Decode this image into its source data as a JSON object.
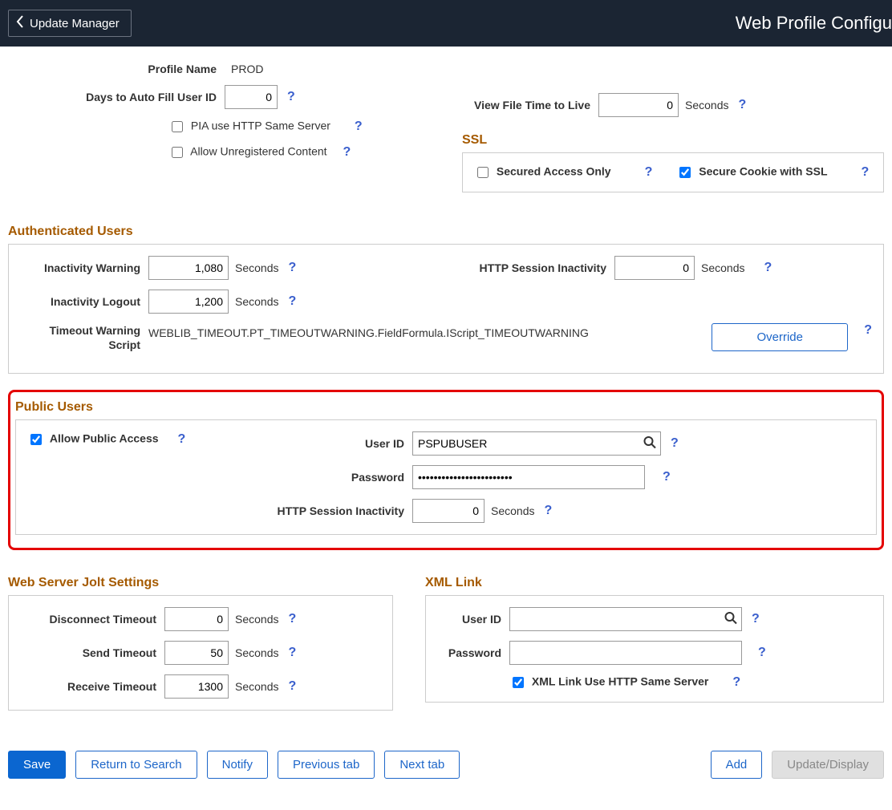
{
  "header": {
    "back_label": "Update Manager",
    "title": "Web Profile Configu"
  },
  "profile": {
    "name_label": "Profile Name",
    "name_value": "PROD",
    "days_autofill_label": "Days to Auto Fill User ID",
    "days_autofill_value": "0",
    "pia_same_server_label": "PIA use HTTP Same Server",
    "pia_same_server_checked": false,
    "allow_unreg_label": "Allow Unregistered Content",
    "allow_unreg_checked": false,
    "view_file_ttl_label": "View File Time to Live",
    "view_file_ttl_value": "0",
    "seconds": "Seconds"
  },
  "ssl": {
    "title": "SSL",
    "secured_only_label": "Secured Access Only",
    "secured_only_checked": false,
    "secure_cookie_label": "Secure Cookie with SSL",
    "secure_cookie_checked": true
  },
  "auth_users": {
    "title": "Authenticated Users",
    "inactivity_warning_label": "Inactivity Warning",
    "inactivity_warning_value": "1,080",
    "inactivity_logout_label": "Inactivity Logout",
    "inactivity_logout_value": "1,200",
    "http_session_label": "HTTP Session Inactivity",
    "http_session_value": "0",
    "timeout_script_label": "Timeout Warning Script",
    "timeout_script_value": "WEBLIB_TIMEOUT.PT_TIMEOUTWARNING.FieldFormula.IScript_TIMEOUTWARNING",
    "override_label": "Override",
    "seconds": "Seconds"
  },
  "public_users": {
    "title": "Public Users",
    "allow_public_label": "Allow Public Access",
    "allow_public_checked": true,
    "user_id_label": "User ID",
    "user_id_value": "PSPUBUSER",
    "password_label": "Password",
    "password_value": "••••••••••••••••••••••••",
    "http_session_label": "HTTP Session Inactivity",
    "http_session_value": "0",
    "seconds": "Seconds"
  },
  "jolt": {
    "title": "Web Server Jolt Settings",
    "disconnect_label": "Disconnect Timeout",
    "disconnect_value": "0",
    "send_label": "Send Timeout",
    "send_value": "50",
    "receive_label": "Receive Timeout",
    "receive_value": "1300",
    "seconds": "Seconds"
  },
  "xmllink": {
    "title": "XML Link",
    "user_id_label": "User ID",
    "user_id_value": "",
    "password_label": "Password",
    "password_value": "",
    "same_server_label": "XML Link Use HTTP Same Server",
    "same_server_checked": true
  },
  "footer": {
    "save": "Save",
    "return_search": "Return to Search",
    "notify": "Notify",
    "prev_tab": "Previous tab",
    "next_tab": "Next tab",
    "add": "Add",
    "update_display": "Update/Display"
  },
  "help": "?"
}
